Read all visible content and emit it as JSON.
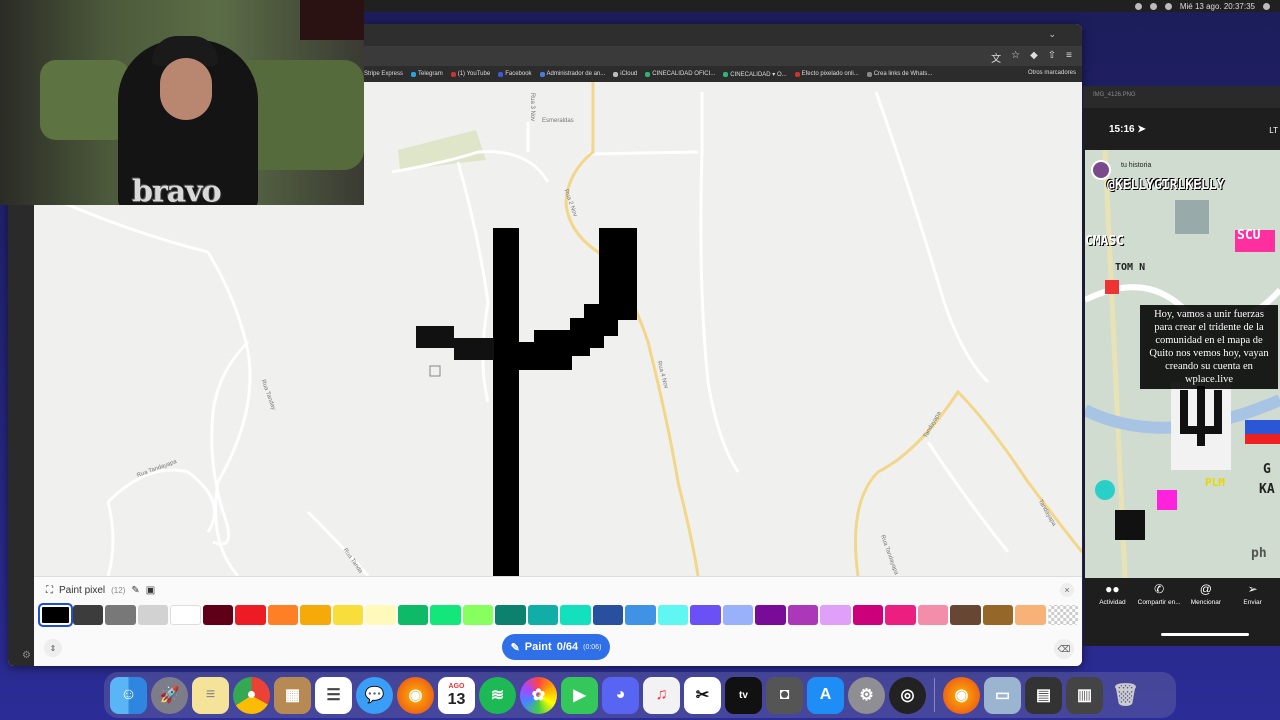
{
  "menubar": {
    "datetime": "Mié 13 ago.  20:37:35"
  },
  "bookmarks": [
    "Stripe Express",
    "Telegram",
    "(1) YouTube",
    "Facebook",
    "Administrador de an...",
    "iCloud",
    "CINECALIDAD OFICI...",
    "CINECALIDAD ▾ O...",
    "Efecto pixelado onli...",
    "Crea links de Whats..."
  ],
  "bookmarks_other": "Otros marcadores",
  "map": {
    "streets": [
      "Esmeraldas",
      "Rua Tanday",
      "Rua Tandayapa",
      "Rua Tandayapa",
      "Rua Tanda",
      "Rua 2 Nov",
      "Rua 3 Nov",
      "Rua 4 Nov",
      "Tandayapa",
      "Tandayapa"
    ]
  },
  "panel": {
    "title": "Paint pixel",
    "count": "(12)",
    "close_icon": "×",
    "paint_label": "Paint",
    "paint_count": "0/64",
    "paint_timer": "(0:06)",
    "colors": [
      "#000000",
      "#3c3c3c",
      "#787878",
      "#d2d2d2",
      "#ffffff",
      "#600018",
      "#ed1c24",
      "#ff7f27",
      "#f6aa09",
      "#f9dd3b",
      "#fffabc",
      "#0eb968",
      "#13e67b",
      "#87ff5e",
      "#0c816e",
      "#10aea6",
      "#13e1be",
      "#28509e",
      "#4093e4",
      "#60f7f2",
      "#6b50f6",
      "#99b1fb",
      "#780c99",
      "#aa38b9",
      "#e09ff9",
      "#cb007a",
      "#ec1f80",
      "#f38da9",
      "#684634",
      "#95682a",
      "#f8b277"
    ],
    "selected_color": "#000000"
  },
  "webcam": {
    "logo": "bravo"
  },
  "phone": {
    "topbar": "IMG_4126.PNG",
    "time": "15:16",
    "network": "LT",
    "historia": "tu historia",
    "username": "@KELLYGIRLKELLY",
    "caption": "Hoy, vamos a unir fuerzas para crear el tridente de la comunidad en el mapa de Quito nos vemos hoy, vayan creando su cuenta en wplace.live",
    "tags": [
      "SCU",
      "CMASC",
      "TOM N",
      "PLM",
      "G",
      "KA",
      "ph"
    ],
    "actions": [
      "Actividad",
      "Compartir en...",
      "Mencionar",
      "Enviar"
    ]
  },
  "dock": {
    "calendar_month": "AGO",
    "calendar_day": "13",
    "apps": [
      "finder-icon",
      "launchpad-icon",
      "notes-icon",
      "chrome-icon",
      "archive-icon",
      "reminders-icon",
      "messages-icon",
      "firefox-icon",
      "calendar-icon",
      "spotify-icon",
      "photos-icon",
      "facetime-icon",
      "discord-icon",
      "music-icon",
      "capcut-icon",
      "appletv-icon",
      "camera-icon",
      "appstore-icon",
      "settings-icon",
      "obs-icon"
    ]
  }
}
